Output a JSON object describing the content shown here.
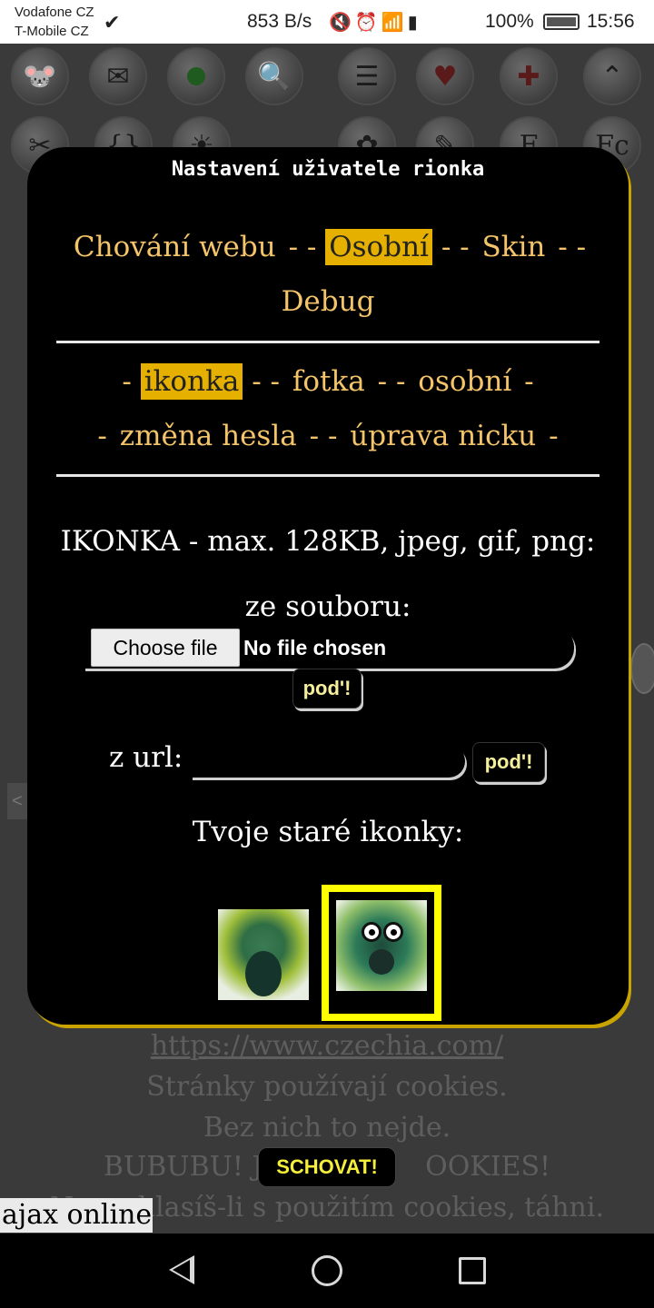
{
  "status_bar": {
    "carrier1": "Vodafone CZ",
    "carrier2": "T-Mobile CZ",
    "net_speed": "853 B/s",
    "battery": "100%",
    "time": "15:56"
  },
  "toolbar": {
    "row1": [
      "mouse-icon",
      "mail-icon",
      "online-dot-icon",
      "search-icon",
      "list-icon",
      "heart-icon",
      "heart-plus-icon",
      "up-chevrons-icon"
    ],
    "row2": [
      "tools-icon",
      "code-icon",
      "bulb-icon",
      "plant-icon",
      "edit-icon",
      "f-icon",
      "fc-icon"
    ]
  },
  "dialog": {
    "title": "Nastavení uživatele rionka",
    "main_tabs": {
      "behavior": "Chování webu",
      "personal": "Osobní",
      "skin": "Skin",
      "debug": "Debug",
      "active": "Osobní"
    },
    "sub_tabs": {
      "icon": "ikonka",
      "photo": "fotka",
      "personal": "osobní",
      "password": "změna hesla",
      "nick": "úprava nicku",
      "active": "ikonka"
    },
    "section_heading": "IKONKA - max. 128KB, jpeg, gif, png:",
    "from_file_label": "ze souboru:",
    "choose_file": "Choose file",
    "no_file": "No file chosen",
    "submit_file": "pod'!",
    "from_url_label": "z url:",
    "url_value": "",
    "submit_url": "pod'!",
    "old_icons_label": "Tvoje staré ikonky:"
  },
  "background": {
    "cookie_link": "https://www.czechia.com/",
    "cookie_line1": "Stránky používají cookies.",
    "cookie_line2": "Bez nich to nejde.",
    "cookie_line3_left": "BUBUBU! JS",
    "cookie_line3_right": "OOKIES!",
    "cookie_line4": "Nesouhlasíš-li s použitím cookies, táhni.",
    "hide_button": "SCHOVAT!",
    "ajax_status": "ajax online"
  }
}
